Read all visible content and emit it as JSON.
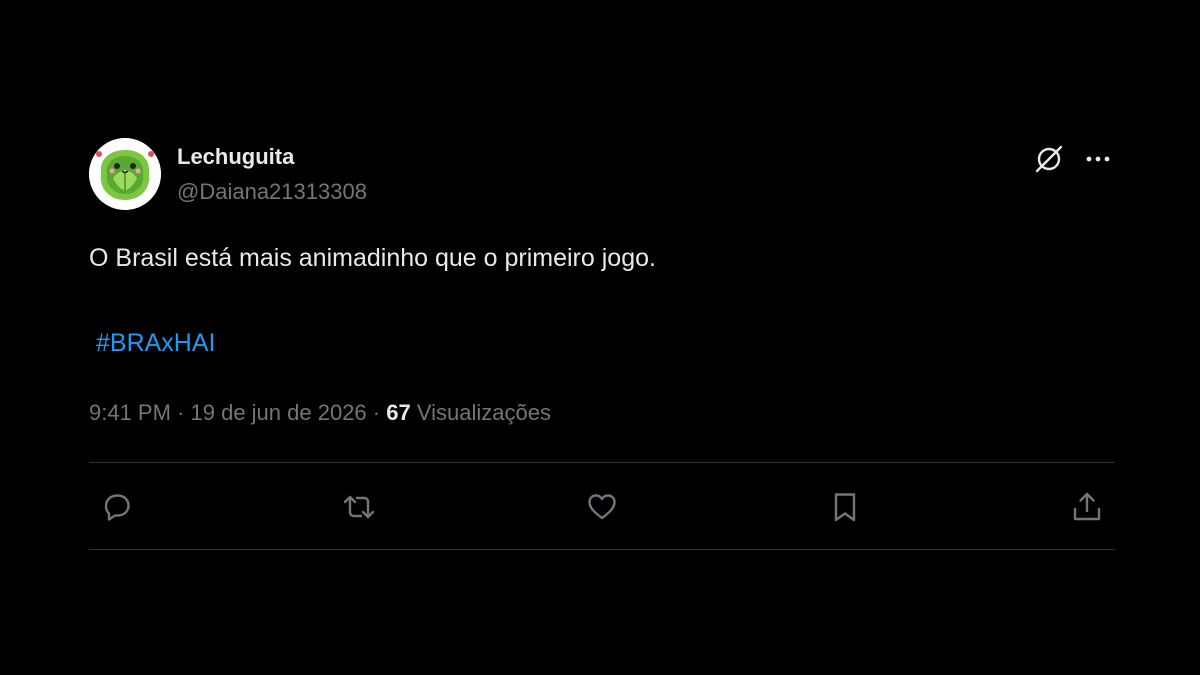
{
  "tweet": {
    "author": {
      "name": "Lechuguita",
      "handle": "@Daiana21313308"
    },
    "text": "O Brasil está mais animadinho que o primeiro jogo.",
    "hashtag": "#BRAxHAI",
    "meta": {
      "time": "9:41 PM",
      "separator": " · ",
      "date": "19 de jun de 2026",
      "views_count": "67",
      "views_label": " Visualizações"
    }
  },
  "icons": {
    "grok": "grok-icon",
    "more": "more-icon",
    "reply": "reply-icon",
    "retweet": "retweet-icon",
    "like": "heart-icon",
    "bookmark": "bookmark-icon",
    "share": "share-icon"
  },
  "colors": {
    "background": "#000000",
    "text": "#e7e9ea",
    "secondary": "#71767b",
    "accent": "#1d9bf0",
    "divider": "#2f3336",
    "avatar_green": "#6cbf3c"
  }
}
